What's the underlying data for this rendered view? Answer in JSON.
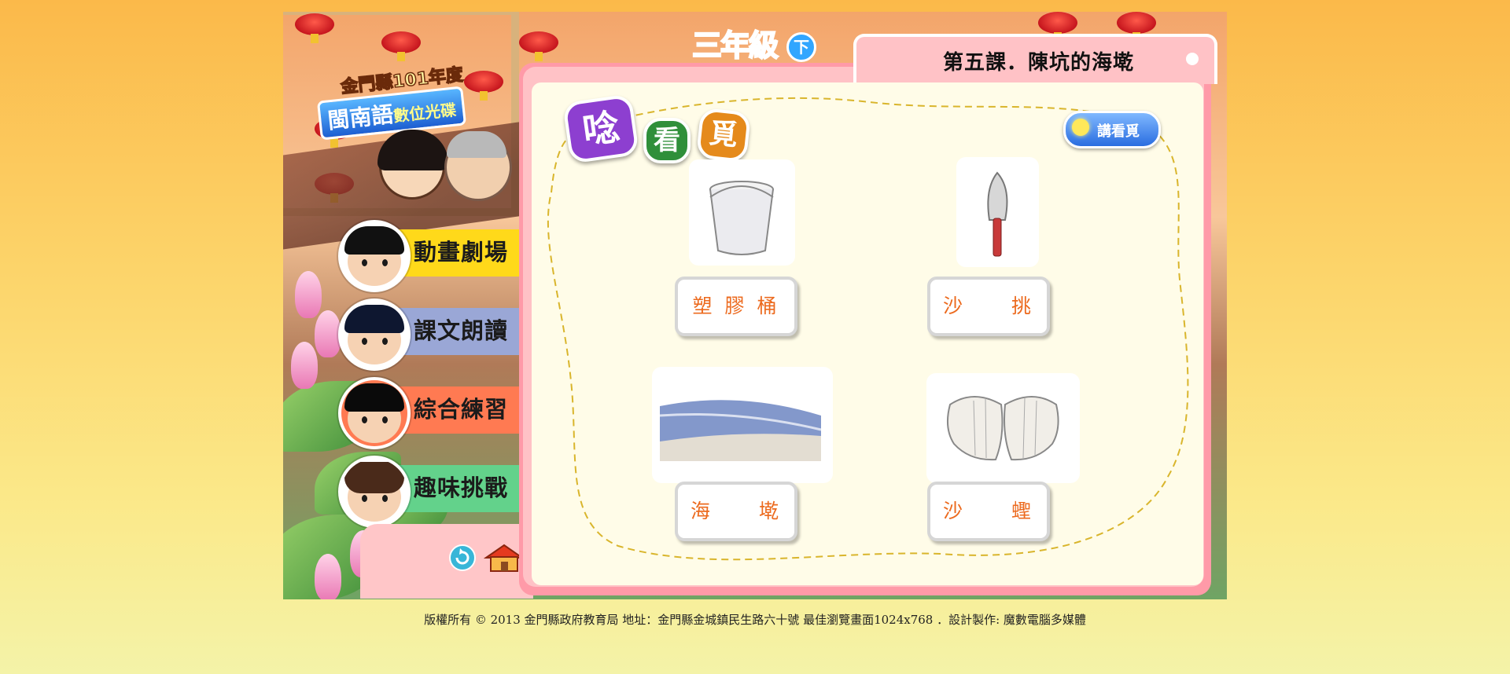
{
  "header": {
    "logo_line1": "金門縣101年度",
    "logo_line2": "閩南語",
    "logo_line3": "數位光碟",
    "grade": "三年級",
    "grade_badge": "下",
    "lesson_title": "第五課．陳坑的海墘"
  },
  "menu": {
    "items": [
      {
        "label": "動畫劇場",
        "color": "#ffd91a"
      },
      {
        "label": "課文朗讀",
        "color": "#9aa7d6"
      },
      {
        "label": "綜合練習",
        "color": "#ff7a52"
      },
      {
        "label": "趣味挑戰",
        "color": "#63d28b"
      }
    ],
    "replay_icon": "replay-icon",
    "home_icon": "home-icon"
  },
  "section": {
    "heading_chars": [
      "唸",
      "看",
      "覓"
    ],
    "heading_colors": [
      "#8d3fd0",
      "#2f8f3a",
      "#e58a1c"
    ],
    "listen_button": "講看覓"
  },
  "items": [
    {
      "label": "塑 膠 桶",
      "icon": "bucket-picture"
    },
    {
      "label": "沙　　挑",
      "icon": "trowel-picture"
    },
    {
      "label": "海　　墘",
      "icon": "seashore-picture"
    },
    {
      "label": "沙　　蟶",
      "icon": "clam-shell-picture"
    }
  ],
  "footer": {
    "text": "版權所有 © 2013  金門縣政府教育局  地址：金門縣金城鎮民生路六十號  最佳瀏覽畫面1024x768  ．設計製作: 魔數電腦多媒體"
  }
}
